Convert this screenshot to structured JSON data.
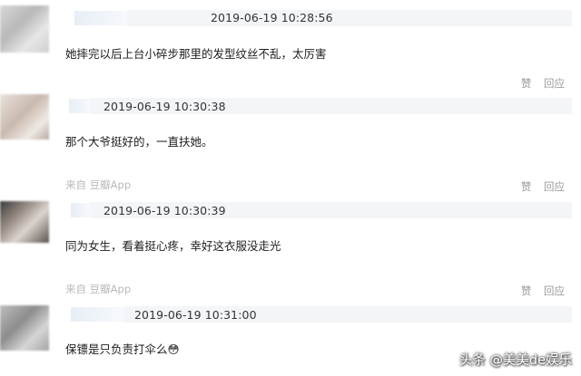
{
  "comments": [
    {
      "timestamp": "2019-06-19 10:28:56",
      "text": "她摔完以后上台小碎步那里的发型纹丝不乱，太厉害",
      "actions": {
        "like": "赞",
        "reply": "回应"
      }
    },
    {
      "timestamp": "2019-06-19 10:30:38",
      "text": "那个大爷挺好的，一直扶她。",
      "source": "来自 豆瓣App",
      "actions": {
        "like": "赞",
        "reply": "回应"
      }
    },
    {
      "timestamp": "2019-06-19 10:30:39",
      "text": "同为女生，看着挺心疼，幸好这衣服没走光",
      "source": "来自 豆瓣App",
      "actions": {
        "like": "赞",
        "reply": "回应"
      }
    },
    {
      "timestamp": "2019-06-19 10:31:00",
      "text": "保镖是只负责打伞么😳"
    }
  ],
  "watermark": "头条 @美美de娱乐"
}
